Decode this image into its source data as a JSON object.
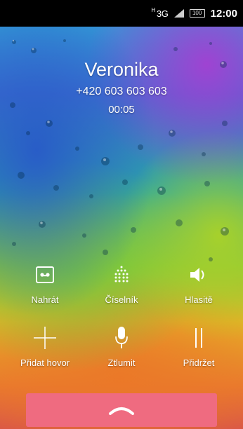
{
  "status_bar": {
    "network": "3G",
    "network_prefix": "H",
    "battery": "100",
    "time": "12:00"
  },
  "call": {
    "name": "Veronika",
    "number": "+420 603 603 603",
    "duration": "00:05"
  },
  "actions": [
    {
      "id": "record",
      "label": "Nahrát",
      "icon": "voicemail-icon"
    },
    {
      "id": "dialpad",
      "label": "Číselník",
      "icon": "dialpad-icon"
    },
    {
      "id": "speaker",
      "label": "Hlasitě",
      "icon": "speaker-icon"
    },
    {
      "id": "add-call",
      "label": "Přidat hovor",
      "icon": "plus-icon"
    },
    {
      "id": "mute",
      "label": "Ztlumit",
      "icon": "microphone-icon"
    },
    {
      "id": "hold",
      "label": "Přidržet",
      "icon": "pause-icon"
    }
  ],
  "end_call": {
    "icon": "hang-up-icon",
    "color": "#ef6b80"
  }
}
